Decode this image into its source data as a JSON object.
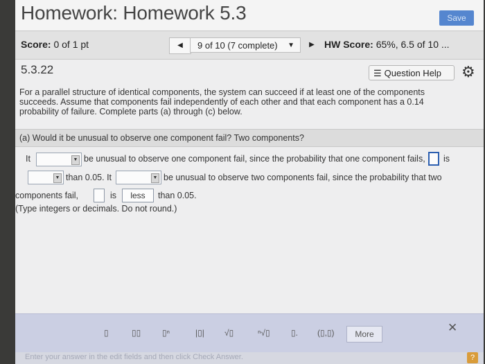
{
  "header": {
    "title": "Homework: Homework 5.3",
    "save_label": "Save"
  },
  "scorebar": {
    "score_label": "Score:",
    "score_value": "0 of 1 pt",
    "question_select": "9 of 10 (7 complete)",
    "hw_score_label": "HW Score:",
    "hw_score_value": "65%, 6.5 of 10 ..."
  },
  "question": {
    "number": "5.3.22",
    "help_label": "Question Help",
    "text": "For a parallel structure of identical components, the system can succeed if at least one of the components succeeds. Assume that components fail independently of each other and that each component has a 0.14 probability of failure. Complete parts (a) through (c) below.",
    "part_a": "(a) Would it be unusual to observe one component fail? Two components?"
  },
  "answer": {
    "w_it1": "It",
    "w_l1b": "be unusual to observe one component fail, since the probability that one component fails,",
    "w_is1": "is",
    "w_than1": "than 0.05. It",
    "w_l2b": "be unusual to observe two components fail, since the probability that two",
    "w_comp": "components fail,",
    "w_is2": "is",
    "less_value": "less",
    "w_than2": "than 0.05.",
    "hint": "(Type integers or decimals. Do not round.)"
  },
  "toolbar": {
    "more_label": "More",
    "tool_labels": [
      "▯",
      "▯▯",
      "▯ⁿ",
      "|▯|",
      "√▯",
      "ⁿ√▯",
      "▯.",
      "(▯,▯)"
    ]
  },
  "footer": {
    "instruction": "Enter your answer in the edit fields and then click Check Answer.",
    "help": "?"
  }
}
